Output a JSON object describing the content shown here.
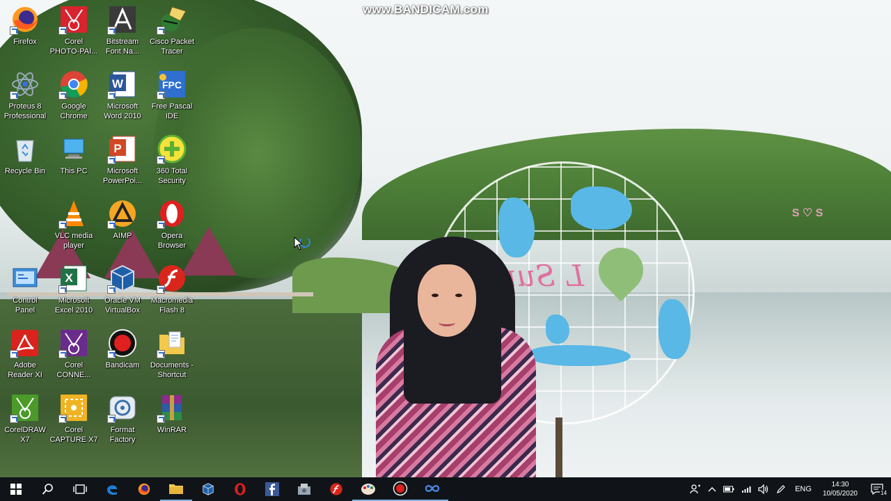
{
  "watermark": "www.BANDICAM.com",
  "wallpaper": {
    "sign_text": "S ♡ S",
    "globe_text": "L Sung"
  },
  "desktop": {
    "icons": [
      {
        "label": "Firefox",
        "icon": "firefox-icon"
      },
      {
        "label": "Corel\nPHOTO-PAI...",
        "icon": "corel-photopaint-icon"
      },
      {
        "label": "Bitstream\nFont Na...",
        "icon": "bitstream-font-icon"
      },
      {
        "label": "Cisco Packet\nTracer",
        "icon": "cisco-packet-tracer-icon"
      },
      {
        "label": "Proteus 8\nProfessional",
        "icon": "proteus-icon"
      },
      {
        "label": "Google\nChrome",
        "icon": "chrome-icon"
      },
      {
        "label": "Microsoft\nWord 2010",
        "icon": "word-icon"
      },
      {
        "label": "Free Pascal\nIDE",
        "icon": "free-pascal-icon"
      },
      {
        "label": "Recycle Bin",
        "icon": "recycle-bin-icon"
      },
      {
        "label": "This PC",
        "icon": "this-pc-icon"
      },
      {
        "label": "Microsoft\nPowerPoi...",
        "icon": "powerpoint-icon"
      },
      {
        "label": "360 Total\nSecurity",
        "icon": "360-security-icon"
      },
      {
        "label": "VLC media\nplayer",
        "icon": "vlc-icon"
      },
      {
        "label": "AIMP",
        "icon": "aimp-icon"
      },
      {
        "label": "Opera\nBrowser",
        "icon": "opera-icon"
      },
      {
        "label": "Control\nPanel",
        "icon": "control-panel-icon"
      },
      {
        "label": "Microsoft\nExcel 2010",
        "icon": "excel-icon"
      },
      {
        "label": "Oracle VM\nVirtualBox",
        "icon": "virtualbox-icon"
      },
      {
        "label": "Macromedia\nFlash 8",
        "icon": "flash-icon"
      },
      {
        "label": "Adobe\nReader XI",
        "icon": "adobe-reader-icon"
      },
      {
        "label": "Corel\nCONNE...",
        "icon": "corel-connect-icon"
      },
      {
        "label": "Bandicam",
        "icon": "bandicam-icon"
      },
      {
        "label": "Documents -\nShortcut",
        "icon": "documents-shortcut-icon"
      },
      {
        "label": "CorelDRAW\nX7",
        "icon": "coreldraw-icon"
      },
      {
        "label": "Corel\nCAPTURE X7",
        "icon": "corel-capture-icon"
      },
      {
        "label": "Format\nFactory",
        "icon": "format-factory-icon"
      },
      {
        "label": "WinRAR",
        "icon": "winrar-icon"
      }
    ]
  },
  "taskbar": {
    "buttons": [
      "windows-start-icon",
      "search-icon",
      "task-view-icon",
      "edge-icon",
      "firefox-icon",
      "file-explorer-icon",
      "virtualbox-icon",
      "opera-icon",
      "facebook-icon",
      "app-icon",
      "flash-icon",
      "paint-icon",
      "bandicam-icon",
      "infinity-icon"
    ],
    "tray": {
      "language": "ENG",
      "time": "14:30",
      "date": "10/05/2020",
      "notification_count": "14"
    }
  },
  "colors": {
    "taskbar": "#101418",
    "label_text": "#ffffff",
    "accent_blue": "#2e6fd0"
  }
}
